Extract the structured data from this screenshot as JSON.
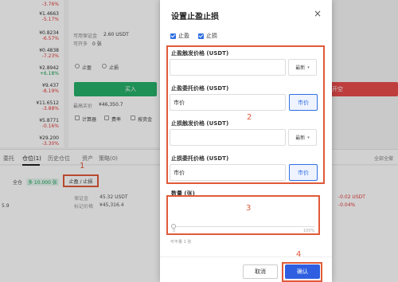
{
  "tickers": [
    {
      "price": "",
      "change": "-3.76%",
      "color": "r"
    },
    {
      "price": "¥1.4663",
      "change": "-5.17%",
      "color": "r"
    },
    {
      "price": "¥0.8234",
      "change": "-6.57%",
      "color": "r"
    },
    {
      "price": "¥0.4838",
      "change": "-7.23%",
      "color": "r"
    },
    {
      "price": "¥2.8942",
      "change": "+6.18%",
      "color": "g"
    },
    {
      "price": "¥9.437",
      "change": "-8.19%",
      "color": "r"
    },
    {
      "price": "¥11.6512",
      "change": "-3.88%",
      "color": "r"
    },
    {
      "price": "¥5.8771",
      "change": "-0.16%",
      "color": "r"
    },
    {
      "price": "¥29.200",
      "change": "-3.30%",
      "color": "r"
    }
  ],
  "mid_panel": {
    "avail_label": "可用保证金",
    "avail_value": "2.60 USDT",
    "maxopen_label": "可开多",
    "maxopen_value": "0 张",
    "tp_label": "止盈",
    "sl_label": "止损",
    "buy_label": "买入",
    "sell_label": "开空",
    "cost_label": "最高买价",
    "cost_value": "¥46,350.7",
    "calc_label": "计算器",
    "fee_label": "费率",
    "cb3_label": "按资金"
  },
  "tabs": [
    "委托",
    "仓位(1)",
    "历史仓位",
    "资产",
    "策略(0)"
  ],
  "right_link": "全部全撤",
  "position": {
    "side": "全仓",
    "tag": "多 10.000 张",
    "sltp_label": "止盈 / 止损",
    "margin_label": "保证金",
    "margin_value": "45.32 USDT",
    "markprice_label": "标记价格",
    "markprice_value": "¥45,316.4",
    "pnl_value": "-0.02 USDT",
    "pnl_pct": "-0.04%",
    "left_num": "5.9"
  },
  "annotations": {
    "a1": "1",
    "a2": "2",
    "a3": "3",
    "a4": "4"
  },
  "modal": {
    "title": "设置止盈止损",
    "close_icon": "×",
    "cb_tp": "止盈",
    "cb_sl": "止损",
    "tp_trigger_label": "止盈触发价格 (USDT)",
    "tp_trigger_value": "",
    "tp_trigger_select": "最新",
    "tp_order_label": "止盈委托价格 (USDT)",
    "tp_order_value": "市价",
    "tp_order_btn": "市价",
    "sl_trigger_label": "止损触发价格 (USDT)",
    "sl_trigger_value": "",
    "sl_trigger_select": "最新",
    "sl_order_label": "止损委托价格 (USDT)",
    "sl_order_value": "市价",
    "sl_order_btn": "市价",
    "qty_label": "数量 (张)",
    "pct_min": "0",
    "pct_max": "100%",
    "avail_text": "可平量 1 张",
    "cancel": "取消",
    "confirm": "确认"
  }
}
